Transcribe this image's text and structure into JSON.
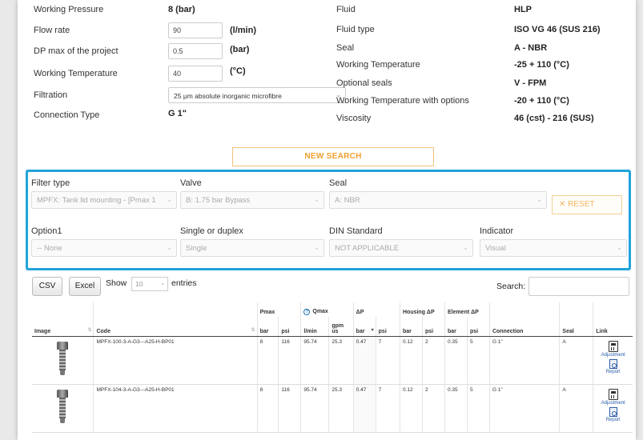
{
  "params": {
    "left": [
      {
        "label": "Working Pressure",
        "value": "8 (bar)",
        "kind": "text"
      },
      {
        "label": "Flow rate",
        "input": "90",
        "unit": "(l/min)",
        "kind": "input"
      },
      {
        "label": "DP max of the project",
        "input": "0.5",
        "unit": "(bar)",
        "kind": "input"
      },
      {
        "label": "Working Temperature",
        "input": "40",
        "unit": "(°C)",
        "kind": "input"
      },
      {
        "label": "Filtration",
        "select": "25 μm absolute inorganic microfibre",
        "kind": "select"
      },
      {
        "label": "Connection Type",
        "value": "G 1\"",
        "kind": "text"
      }
    ],
    "right": [
      {
        "label": "Fluid",
        "value": "HLP"
      },
      {
        "label": "Fluid type",
        "value": "ISO VG 46 (SUS 216)"
      },
      {
        "label": "Seal",
        "value": "A - NBR"
      },
      {
        "label": "Working Temperature",
        "value": "-25 + 110 (°C)"
      },
      {
        "label": "Optional seals",
        "value": "V - FPM"
      },
      {
        "label": "Working Temperature with options",
        "value": "-20 + 110 (°C)"
      },
      {
        "label": "Viscosity",
        "value": "46 (cst) - 216 (SUS)"
      }
    ]
  },
  "new_search_label": "NEW SEARCH",
  "filters": {
    "filter_type": {
      "label": "Filter type",
      "value": "MPFX: Tank lid mounting - [Pmax 1"
    },
    "valve": {
      "label": "Valve",
      "value": "B: 1.75 bar Bypass"
    },
    "seal": {
      "label": "Seal",
      "value": "A: NBR"
    },
    "reset_label": "✕ RESET",
    "option1": {
      "label": "Option1",
      "value": "-- None"
    },
    "single_duplex": {
      "label": "Single or duplex",
      "value": "Single"
    },
    "din": {
      "label": "DIN Standard",
      "value": "NOT APPLICABLE"
    },
    "indicator": {
      "label": "Indicator",
      "value": "Visual"
    }
  },
  "table_controls": {
    "csv": "CSV",
    "excel": "Excel",
    "show": "Show",
    "entries_value": "10",
    "entries": "entries",
    "search": "Search:"
  },
  "table": {
    "group_headers": {
      "pmax": "Pmax",
      "qmax": "Qmax",
      "dp": "ΔP",
      "housing": "Housing ΔP",
      "element": "Element ΔP"
    },
    "headers": {
      "image": "Image",
      "code": "Code",
      "bar": "bar",
      "psi": "psi",
      "lmin": "l/min",
      "gpm": "gpm us",
      "connection": "Connection",
      "seal": "Seal",
      "link": "Link"
    },
    "rows": [
      {
        "code": "MPFX-100-3-A-G3---A25-H-BP01",
        "pmax_bar": "8",
        "pmax_psi": "116",
        "qmax_lmin": "95.74",
        "qmax_gpm": "25.3",
        "dp_bar": "0.47",
        "dp_psi": "7",
        "housing_bar": "0.12",
        "housing_psi": "2",
        "element_bar": "0.35",
        "element_psi": "5",
        "connection": "G 1\"",
        "seal": "A",
        "adjustment": "Adjustment",
        "report": "Report"
      },
      {
        "code": "MPFX-104-3-A-G3---A25-H-BP01",
        "pmax_bar": "8",
        "pmax_psi": "116",
        "qmax_lmin": "95.74",
        "qmax_gpm": "25.3",
        "dp_bar": "0.47",
        "dp_psi": "7",
        "housing_bar": "0.12",
        "housing_psi": "2",
        "element_bar": "0.35",
        "element_psi": "5",
        "connection": "G 1\"",
        "seal": "A",
        "adjustment": "Adjustment",
        "report": "Report"
      }
    ]
  },
  "colors": {
    "accent_blue": "#1ea3dc",
    "orange": "#f0a030"
  }
}
